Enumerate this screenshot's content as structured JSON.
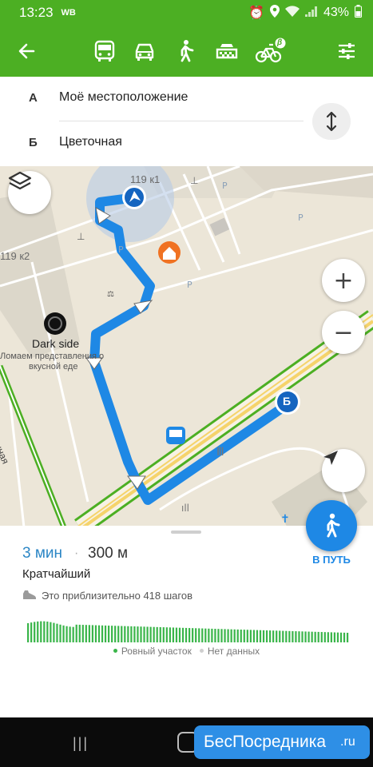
{
  "status_bar": {
    "time": "13:23",
    "carrier": "WB",
    "battery": "43%"
  },
  "toolbar": {
    "back_icon": "arrow-left-icon",
    "modes": [
      "bus-icon",
      "car-icon",
      "pedestrian-icon",
      "taxi-icon",
      "bicycle-icon"
    ],
    "selected_mode": "pedestrian",
    "bike_badge": "β",
    "settings_icon": "sliders-icon",
    "accent_color": "#4caf23"
  },
  "route": {
    "from_letter": "А",
    "from_label": "Моё местоположение",
    "to_letter": "Б",
    "to_label": "Цветочная"
  },
  "map": {
    "building_labels": [
      "119 к1",
      "119 к2"
    ],
    "poi_name": "Dark side",
    "poi_desc_line1": "Ломаем представления о",
    "poi_desc_line2": "вкусной еде",
    "street_name": "Цветочная",
    "end_marker": "Б",
    "zoom_in": "+",
    "zoom_out": "−"
  },
  "summary": {
    "time": "3 мин",
    "separator": "·",
    "distance": "300 м",
    "route_type": "Кратчайший",
    "steps_text": "Это приблизительно 418 шагов",
    "legend_flat": "Ровный участок",
    "legend_nodata": "Нет данных",
    "flat_color": "#3ab54a",
    "nodata_color": "#cfcfcf"
  },
  "go_button": {
    "label": "В ПУТЬ",
    "icon": "pedestrian-icon"
  },
  "watermark": {
    "text": "БесПосредника",
    "suffix": ".ru"
  }
}
